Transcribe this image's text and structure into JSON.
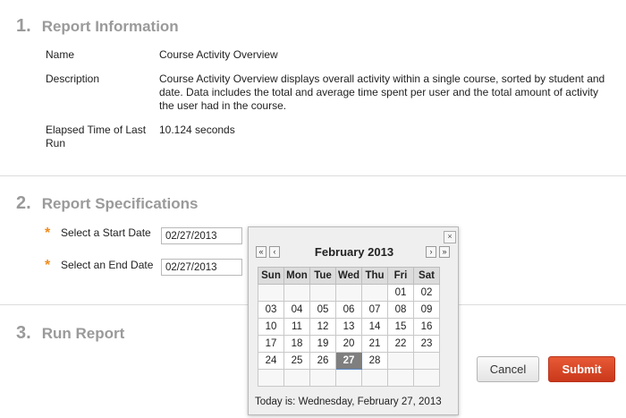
{
  "section1": {
    "number": "1.",
    "title": "Report Information",
    "rows": [
      {
        "label": "Name",
        "value": "Course Activity Overview"
      },
      {
        "label": "Description",
        "value": "Course Activity Overview displays overall activity within a single course, sorted by student and date. Data includes the total and average time spent per user and the total amount of activity the user had in the course."
      },
      {
        "label": "Elapsed Time of Last Run",
        "value": "10.124 seconds"
      }
    ]
  },
  "section2": {
    "number": "2.",
    "title": "Report Specifications",
    "required_mark": "*",
    "start_label": "Select a Start Date",
    "start_value": "02/27/2013",
    "end_label": "Select an End Date",
    "end_value": "02/27/2013"
  },
  "section3": {
    "number": "3.",
    "title": "Run Report"
  },
  "buttons": {
    "cancel": "Cancel",
    "submit": "Submit"
  },
  "calendar": {
    "month_title": "February 2013",
    "close": "×",
    "prev_year": "«",
    "prev_month": "‹",
    "next_month": "›",
    "next_year": "»",
    "weekdays": [
      "Sun",
      "Mon",
      "Tue",
      "Wed",
      "Thu",
      "Fri",
      "Sat"
    ],
    "weeks": [
      [
        "",
        "",
        "",
        "",
        "",
        "01",
        "02"
      ],
      [
        "03",
        "04",
        "05",
        "06",
        "07",
        "08",
        "09"
      ],
      [
        "10",
        "11",
        "12",
        "13",
        "14",
        "15",
        "16"
      ],
      [
        "17",
        "18",
        "19",
        "20",
        "21",
        "22",
        "23"
      ],
      [
        "24",
        "25",
        "26",
        "27",
        "28",
        "",
        ""
      ],
      [
        "",
        "",
        "",
        "",
        "",
        "",
        ""
      ]
    ],
    "selected_day": "27",
    "today_text": "Today is: Wednesday, February 27, 2013"
  },
  "colors": {
    "accent_required": "#f08c1c",
    "submit_bg": "#d9461f",
    "heading_gray": "#9a9a9a"
  }
}
